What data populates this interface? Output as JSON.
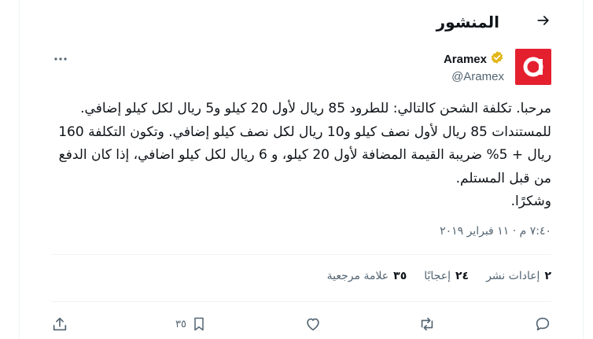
{
  "header": {
    "title": "المنشور",
    "back_icon": "arrow-right-icon"
  },
  "author": {
    "display_name": "Aramex",
    "handle": "@Aramex",
    "verified_badge": "gold-verified-icon",
    "avatar_letter": "a",
    "avatar_color": "#e4202f"
  },
  "tweet": {
    "text": "مرحبا. تكلفة الشحن كالتالي: للطرود 85 ريال لأول 20 كيلو و5 ريال لكل كيلو إضافي. للمستندات 85 ريال لأول نصف كيلو و10 ريال لكل نصف كيلو إضافي. وتكون التكلفة 160 ريال + 5% ضريبة القيمة المضافة لأول 20 كيلو، و 6 ريال لكل كيلو اضافي، إذا كان الدفع من قبل المستلم.\nوشكرًا.",
    "timestamp": "٧:٤٠ م · ١١ فبراير ٢٠١٩"
  },
  "stats": {
    "reposts": {
      "count": "٢",
      "label": "إعادات نشر"
    },
    "likes": {
      "count": "٢٤",
      "label": "إعجابًا"
    },
    "bookmarks": {
      "count": "٣٥",
      "label": "علامة مرجعية"
    }
  },
  "actions": {
    "bookmark_count": "٣٥",
    "reply_icon": "reply-icon",
    "repost_icon": "repost-icon",
    "like_icon": "heart-icon",
    "bookmark_icon": "bookmark-icon",
    "share_icon": "share-icon"
  },
  "colors": {
    "text": "#0f1419",
    "secondary": "#536471",
    "border": "#eff3f4",
    "verified_gold": "#e2b719"
  }
}
